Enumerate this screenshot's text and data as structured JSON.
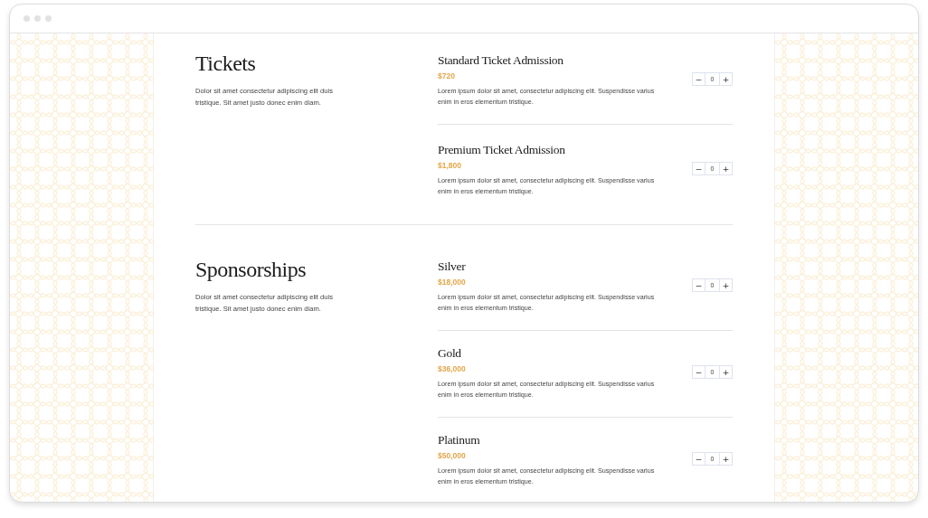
{
  "sections": [
    {
      "title": "Tickets",
      "description": "Dolor sit amet consectetur adipiscing elit duis tristique. Sit amet justo donec enim diam.",
      "items": [
        {
          "name": "Standard Ticket Admission",
          "price": "$720",
          "description": "Lorem ipsum dolor sit amet, consectetur adipiscing elit. Suspendisse varius enim in eros elementum tristique.",
          "quantity": "0",
          "minus": "−",
          "plus": "+"
        },
        {
          "name": "Premium Ticket Admission",
          "price": "$1,800",
          "description": "Lorem ipsum dolor sit amet, consectetur adipiscing elit. Suspendisse varius enim in eros elementum tristique.",
          "quantity": "0",
          "minus": "−",
          "plus": "+"
        }
      ]
    },
    {
      "title": "Sponsorships",
      "description": "Dolor sit amet consectetur adipiscing elit duis tristique. Sit amet justo donec enim diam.",
      "items": [
        {
          "name": "Silver",
          "price": "$18,000",
          "description": "Lorem ipsum dolor sit amet, consectetur adipiscing elit. Suspendisse varius enim in eros elementum tristique.",
          "quantity": "0",
          "minus": "−",
          "plus": "+"
        },
        {
          "name": "Gold",
          "price": "$36,000",
          "description": "Lorem ipsum dolor sit amet, consectetur adipiscing elit. Suspendisse varius enim in eros elementum tristique.",
          "quantity": "0",
          "minus": "−",
          "plus": "+"
        },
        {
          "name": "Platinum",
          "price": "$50,000",
          "description": "Lorem ipsum dolor sit amet, consectetur adipiscing elit. Suspendisse varius enim in eros elementum tristique.",
          "quantity": "0",
          "minus": "−",
          "plus": "+"
        }
      ]
    }
  ]
}
